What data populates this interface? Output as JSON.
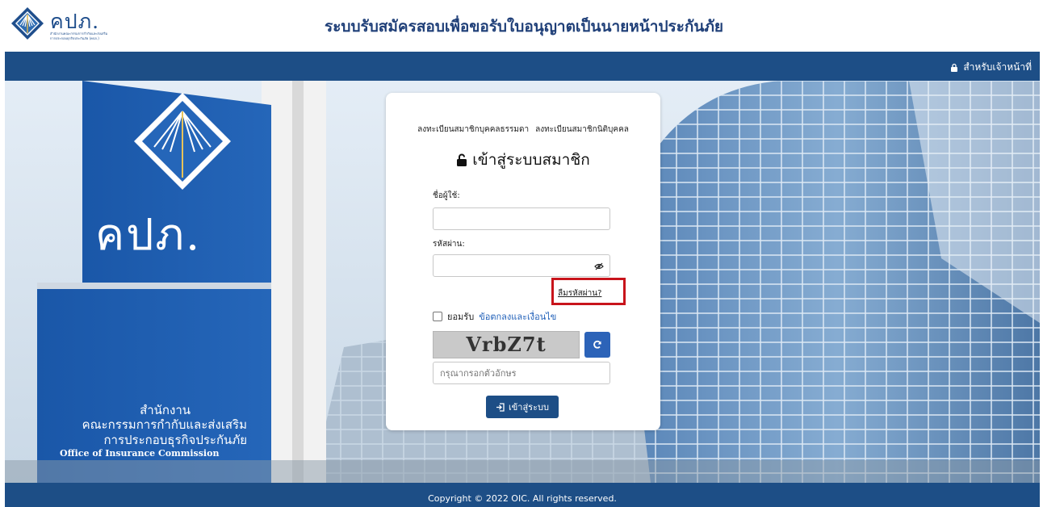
{
  "header": {
    "logo_text": "คปภ.",
    "logo_sub_line1": "สำนักงานคณะกรรมการกำกับและส่งเสริม",
    "logo_sub_line2": "การประกอบธุรกิจประกันภัย (คปภ.)",
    "title": "ระบบรับสมัครสอบเพื่อขอรับใบอนุญาตเป็นนายหน้าประกันภัย"
  },
  "nav": {
    "staff_link": "สำหรับเจ้าหน้าที่"
  },
  "sign": {
    "big_text": "คปภ.",
    "line1": "สำนักงาน",
    "line2": "คณะกรรมการกำกับและส่งเสริม",
    "line3": "การประกอบธุรกิจประกันภัย",
    "line4": "Office of Insurance Commission"
  },
  "login": {
    "register_individual": "ลงทะเบียนสมาชิกบุคคลธรรมดา",
    "register_juristic": "ลงทะเบียนสมาชิกนิติบุคคล",
    "title": "เข้าสู่ระบบสมาชิก",
    "username_label": "ชื่อผู้ใช้:",
    "username_value": "",
    "password_label": "รหัสผ่าน:",
    "password_value": "",
    "forgot_password": "ลืมรหัสผ่าน?",
    "agree_prefix": "ยอมรับ",
    "terms_link": "ข้อตกลงและเงื่อนไข",
    "agree_checked": false,
    "captcha_text": "VrbZ7t",
    "captcha_placeholder": "กรุณากรอกตัวอักษร",
    "login_button": "เข้าสู่ระบบ"
  },
  "footer": {
    "copyright": "Copyright © 2022 OIC. All rights reserved."
  },
  "colors": {
    "brand_blue": "#1d4e86",
    "link_blue": "#1f5fb8",
    "highlight_red": "#c8141b"
  },
  "icons": [
    "oic-logo-icon",
    "lock-icon",
    "unlock-icon",
    "eye-slash-icon",
    "refresh-icon",
    "sign-in-icon"
  ]
}
